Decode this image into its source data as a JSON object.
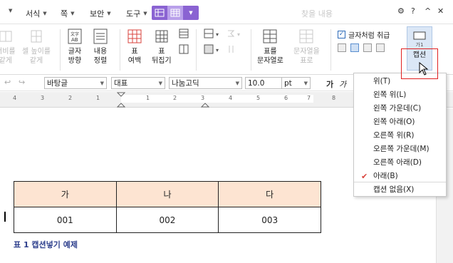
{
  "menu": {
    "items": [
      {
        "label": ""
      },
      {
        "label": "서식"
      },
      {
        "label": "쪽"
      },
      {
        "label": "보안"
      },
      {
        "label": "도구"
      }
    ],
    "search_placeholder": "찾을 내용",
    "window_controls": [
      "⚙",
      "?",
      "^",
      "✕"
    ]
  },
  "ribbon": {
    "cell_height_label": [
      "셀 높이를",
      "같게"
    ],
    "cell_width_label": [
      "너비를",
      "같게"
    ],
    "text_direction": [
      "글자",
      "방향"
    ],
    "content_align": [
      "내용",
      "정렬"
    ],
    "table_margin": [
      "표",
      "여백"
    ],
    "table_flip": [
      "표",
      "뒤집기"
    ],
    "to_text": [
      "표를",
      "문자열로"
    ],
    "to_table": [
      "문자열을",
      "표로"
    ],
    "treat_as_char": "글자처럼 취급",
    "treat_as_char_checked": true,
    "caption": {
      "icon_text": "가1",
      "label": "캡션"
    }
  },
  "toolbar": {
    "style": "바탕글",
    "representative": "대표",
    "font": "나눔고딕",
    "size": "10.0",
    "unit": "pt",
    "bold": "가",
    "italic": "가"
  },
  "ruler": {
    "numbers": [
      "4",
      "3",
      "2",
      "1",
      "1",
      "2",
      "3",
      "4",
      "5",
      "6",
      "7",
      "8"
    ]
  },
  "caption_menu": {
    "items": [
      {
        "label": "위(T)",
        "checked": false
      },
      {
        "label": "왼쪽 위(L)",
        "checked": false
      },
      {
        "label": "왼쪽 가운데(C)",
        "checked": false
      },
      {
        "label": "왼쪽 아래(O)",
        "checked": false
      },
      {
        "label": "오른쪽 위(R)",
        "checked": false
      },
      {
        "label": "오른쪽 가운데(M)",
        "checked": false
      },
      {
        "label": "오른쪽 아래(D)",
        "checked": false
      },
      {
        "label": "아래(B)",
        "checked": true
      },
      {
        "label": "캡션 없음(X)",
        "checked": false
      }
    ]
  },
  "document": {
    "table": {
      "header": [
        "가",
        "나",
        "다"
      ],
      "row": [
        "001",
        "002",
        "003"
      ]
    },
    "caption": "표 1 캡션넣기 예제"
  },
  "colors": {
    "accent_purple": "#8a63d2",
    "caption_text": "#2c3e8c",
    "table_header_bg": "#fde4d2",
    "highlight_border": "#e02020"
  }
}
